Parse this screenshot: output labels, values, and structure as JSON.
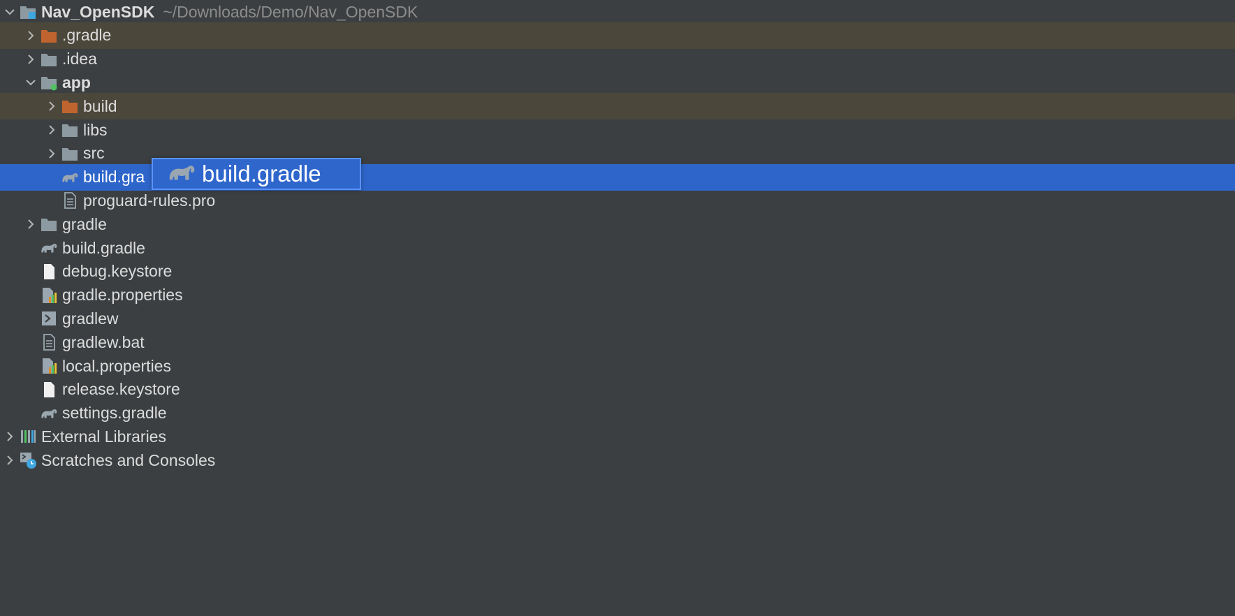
{
  "project": {
    "name": "Nav_OpenSDK",
    "path": "~/Downloads/Demo/Nav_OpenSDK"
  },
  "tree": [
    {
      "label": "Nav_OpenSDK",
      "path": "~/Downloads/Demo/Nav_OpenSDK",
      "depth": 0,
      "arrow": "down",
      "icon": "module-folder-icon",
      "bold": true,
      "state": "normal"
    },
    {
      "label": ".gradle",
      "depth": 1,
      "arrow": "right",
      "icon": "excluded-folder-icon",
      "bold": false,
      "state": "excluded"
    },
    {
      "label": ".idea",
      "depth": 1,
      "arrow": "right",
      "icon": "folder-icon",
      "bold": false,
      "state": "normal"
    },
    {
      "label": "app",
      "depth": 1,
      "arrow": "down",
      "icon": "app-module-folder-icon",
      "bold": true,
      "state": "normal"
    },
    {
      "label": "build",
      "depth": 2,
      "arrow": "right",
      "icon": "excluded-folder-icon",
      "bold": false,
      "state": "excluded"
    },
    {
      "label": "libs",
      "depth": 2,
      "arrow": "right",
      "icon": "folder-icon",
      "bold": false,
      "state": "normal"
    },
    {
      "label": "src",
      "depth": 2,
      "arrow": "right",
      "icon": "folder-icon",
      "bold": false,
      "state": "normal"
    },
    {
      "label": "build.gra",
      "depth": 2,
      "arrow": "none",
      "icon": "gradle-elephant-icon",
      "bold": false,
      "state": "selected"
    },
    {
      "label": "proguard-rules.pro",
      "depth": 2,
      "arrow": "none",
      "icon": "text-file-icon",
      "bold": false,
      "state": "normal"
    },
    {
      "label": "gradle",
      "depth": 1,
      "arrow": "right",
      "icon": "folder-icon",
      "bold": false,
      "state": "normal"
    },
    {
      "label": "build.gradle",
      "depth": 1,
      "arrow": "none",
      "icon": "gradle-elephant-icon",
      "bold": false,
      "state": "normal"
    },
    {
      "label": "debug.keystore",
      "depth": 1,
      "arrow": "none",
      "icon": "blank-file-icon",
      "bold": false,
      "state": "normal"
    },
    {
      "label": "gradle.properties",
      "depth": 1,
      "arrow": "none",
      "icon": "properties-file-icon",
      "bold": false,
      "state": "normal"
    },
    {
      "label": "gradlew",
      "depth": 1,
      "arrow": "none",
      "icon": "shell-script-icon",
      "bold": false,
      "state": "normal"
    },
    {
      "label": "gradlew.bat",
      "depth": 1,
      "arrow": "none",
      "icon": "text-file-icon",
      "bold": false,
      "state": "normal"
    },
    {
      "label": "local.properties",
      "depth": 1,
      "arrow": "none",
      "icon": "properties-file-icon",
      "bold": false,
      "state": "normal"
    },
    {
      "label": "release.keystore",
      "depth": 1,
      "arrow": "none",
      "icon": "blank-file-icon",
      "bold": false,
      "state": "normal"
    },
    {
      "label": "settings.gradle",
      "depth": 1,
      "arrow": "none",
      "icon": "gradle-elephant-icon",
      "bold": false,
      "state": "normal"
    },
    {
      "label": "External Libraries",
      "depth": 0,
      "arrow": "right",
      "icon": "library-icon",
      "bold": false,
      "state": "normal"
    },
    {
      "label": "Scratches and Consoles",
      "depth": 0,
      "arrow": "right",
      "icon": "scratches-icon",
      "bold": false,
      "state": "normal"
    }
  ],
  "drag_preview": {
    "label": "build.gradle",
    "icon": "gradle-elephant-icon"
  },
  "colors": {
    "background": "#3c3f41",
    "selection": "#2e65ca",
    "excluded_row": "#4b473b",
    "excluded_folder": "#c0642f",
    "folder": "#8d9aa2",
    "module_badge": "#3fa6e0",
    "app_badge": "#52c162"
  }
}
